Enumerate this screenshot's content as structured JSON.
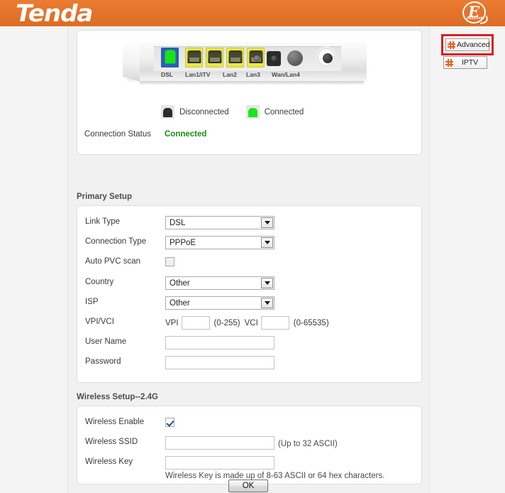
{
  "header": {
    "brand": "Tenda",
    "logo_mark_letter": "E",
    "logo_mark_sub": "easylink",
    "bg_color": "#e8762c"
  },
  "nav": {
    "advanced_label": "Advanced",
    "iptv_label": "IPTV",
    "highlight_color": "#d81f1f",
    "icon_color": "#e8621e"
  },
  "status_panel": {
    "router_ports": [
      "DSL",
      "Lan1/iTV",
      "Lan2",
      "Lan3",
      "Wan/Lan4"
    ],
    "legend": [
      {
        "label": "Disconnected",
        "color": "#2c2c2c"
      },
      {
        "label": "Connected",
        "color": "#1ae61a"
      }
    ],
    "connection_status_label": "Connection Status",
    "connection_status_value": "Connected",
    "connection_status_color": "#139013"
  },
  "primary_setup": {
    "title": "Primary Setup",
    "link_type": {
      "label": "Link Type",
      "value": "DSL"
    },
    "connection_type": {
      "label": "Connection Type",
      "value": "PPPoE"
    },
    "auto_pvc_scan": {
      "label": "Auto PVC scan",
      "checked": false
    },
    "country": {
      "label": "Country",
      "value": "Other"
    },
    "isp": {
      "label": "ISP",
      "value": "Other"
    },
    "vpi_vci": {
      "label": "VPI/VCI",
      "vpi_label": "VPI",
      "vpi_value": "",
      "vpi_range": "(0-255)",
      "vci_label": "VCI",
      "vci_value": "",
      "vci_range": "(0-65535)"
    },
    "user_name": {
      "label": "User Name",
      "value": ""
    },
    "password": {
      "label": "Password",
      "value": ""
    }
  },
  "wireless_setup": {
    "title": "Wireless Setup--2.4G",
    "wireless_enable": {
      "label": "Wireless Enable",
      "checked": true
    },
    "wireless_ssid": {
      "label": "Wireless SSID",
      "value": "",
      "hint": "(Up to 32 ASCII)"
    },
    "wireless_key": {
      "label": "Wireless Key",
      "value": ""
    },
    "key_hint": "Wireless Key is made up of 8-63 ASCII or 64 hex characters."
  },
  "footer": {
    "ok_label": "OK"
  }
}
